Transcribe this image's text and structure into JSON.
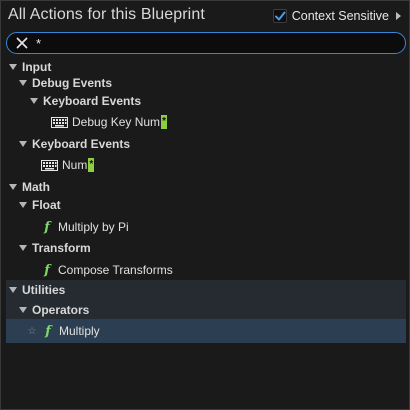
{
  "header": {
    "title": "All Actions for this Blueprint",
    "context_sensitive_label": "Context Sensitive",
    "context_sensitive_checked": true
  },
  "search": {
    "value": "*",
    "placeholder": ""
  },
  "tree": {
    "input_label": "Input",
    "debug_events_label": "Debug Events",
    "keyboard_events_nested_label": "Keyboard Events",
    "debug_key_num_label": "Debug Key Num",
    "debug_key_num_highlight": "*",
    "keyboard_events_label": "Keyboard Events",
    "num_label": "Num",
    "num_highlight": "*",
    "math_label": "Math",
    "float_label": "Float",
    "multiply_by_pi_label": "Multiply by Pi",
    "transform_label": "Transform",
    "compose_transforms_label": "Compose Transforms",
    "utilities_label": "Utilities",
    "operators_label": "Operators",
    "multiply_label": "Multiply"
  },
  "icons": {
    "function": "f",
    "keyboard": "keyboard-icon",
    "favorite": "☆"
  },
  "colors": {
    "accent": "#3a86d6",
    "function_icon": "#7fd86a",
    "match_highlight": "#8ecf42",
    "selected_row": "#2c3f52"
  }
}
